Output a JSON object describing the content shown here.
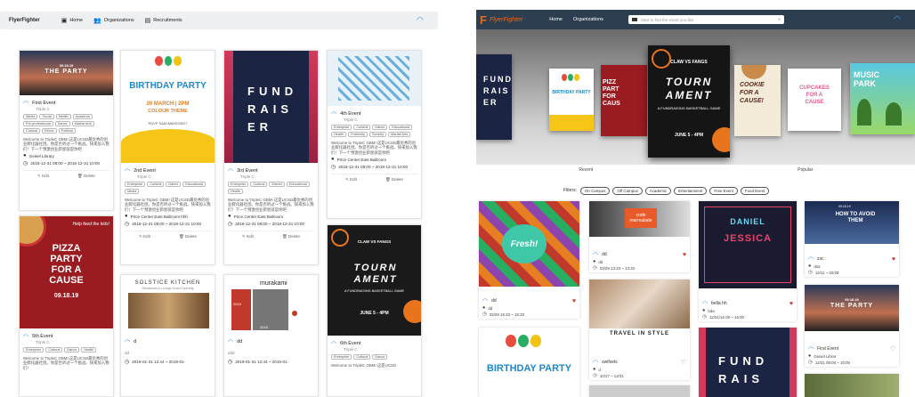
{
  "left": {
    "brand": "FlyerFighter",
    "nav": [
      {
        "label": "Home",
        "icon": "home-icon"
      },
      {
        "label": "Organizations",
        "icon": "people-icon"
      },
      {
        "label": "Recruitments",
        "icon": "document-icon"
      }
    ],
    "cards": [
      {
        "title": "First Event",
        "org": "Triple C",
        "tags": [
          "Media",
          "Social",
          "Health",
          "Academic",
          "Pre-professional",
          "Dance",
          "Martial Arts",
          "Cultural",
          "Ethnic",
          "Political"
        ],
        "desc": "Welcome to TripleC GBM! 这是UCSD最优秀的创业孵化器社团。你是否听过一个挑战。快来加入我们！下一个预激创业新星就是你吧",
        "location": "Geisel Library",
        "date": "2018-12-31 08:00 ~ 2018-12-31 10:00",
        "edit": "Edit",
        "delete": "Delete",
        "poster_top": "09.18.19",
        "poster_main": "THE PARTY"
      },
      {
        "title": "2nd Event",
        "org": "Triple C",
        "tags": [
          "Enterprise",
          "Cultural",
          "Dance",
          "Educational",
          "Media"
        ],
        "desc": "Welcome to TripleC GBM! 这是UCSD最优秀的创业孵化器社团。你是否听过一个挑战。快来加入我们！下一个预激创业新星就是你吧",
        "location": "Price Center East Ballroom hhh",
        "date": "2018-12-31 08:00 ~ 2018-12-31 10:00",
        "edit": "Edit",
        "delete": "Delete",
        "poster_main": "BIRTHDAY PARTY",
        "poster_sub": "20 MARCH | 2PM",
        "poster_sub2": "COLOUR THEME",
        "poster_rsvp": "RSVP SAM 8862533027"
      },
      {
        "title": "3rd Event",
        "org": "Triple C",
        "tags": [
          "Enterprise",
          "Cultural",
          "Marvel",
          "Educational",
          "Health"
        ],
        "desc": "Welcome to TripleC GBM! 这是UCSD最优秀的创业孵化器社团。你是否听过一个挑战。快来加入我们！下一个预激创业新星就是你吧",
        "location": "Price Center East Ballroom",
        "date": "2018-12-31 08:00 ~ 2018-12-31 10:00",
        "edit": "Edit",
        "delete": "Delete",
        "poster_lines": [
          "FUND",
          "RAIS",
          "ER"
        ]
      },
      {
        "title": "4th Event",
        "org": "Triple C",
        "tags": [
          "Enterprise",
          "Cultural",
          "Dance",
          "Educational",
          "Health",
          "Fraternity",
          "Sorority",
          "Martial Arts"
        ],
        "desc": "Welcome to TripleC GBM! 这是UCSD最优秀的创业孵化器社团。你是否听过一个挑战。快来加入我们！下一个预激创业新星就是你吧",
        "location": "Price Center East Ballroom",
        "date": "2018-12-31 08:00 ~ 2018-12-31 10:00",
        "edit": "Edit",
        "delete": "Delete"
      },
      {
        "title": "5th Event",
        "org": "Triple C",
        "tags": [
          "Enterprise",
          "Cultural",
          "Dance",
          "Health"
        ],
        "desc": "Welcome to TripleC GBM! 这是UCSD最优秀的创业孵化器社团。你是否听过一个挑战。快来加入我们！",
        "poster_script": "Help feed the kids!",
        "poster_lines": [
          "PIZZA",
          "PARTY",
          "FOR A",
          "CAUSE"
        ],
        "poster_date": "09.18.19"
      },
      {
        "title": "d",
        "org": "dd",
        "date": "2019-01-31 12:44 ~ 2019-01-",
        "poster_main": "SOLSTICE KITCHEN",
        "poster_sub": "Restaurant & Lounge Grand Opening"
      },
      {
        "title": "dd",
        "org": "ddd",
        "date": "2019-01-31 12:44 ~ 2019-01-",
        "poster_main": "murakami",
        "poster_left": "2019",
        "poster_mid": "2016"
      },
      {
        "title": "6th Event",
        "org": "Triple C",
        "tags": [
          "Enterprise",
          "Cultural",
          "Dance"
        ],
        "desc": "Welcome to TripleC GBM! 这是UCSD",
        "poster_top": "CLAW VS FANGS",
        "poster_main": "TOURN AMENT",
        "poster_sub": "A FUNDRAISING BASKETBALL GAME",
        "poster_date": "JUNE 5 - 4PM"
      }
    ]
  },
  "right": {
    "brand": "FlyerFighter",
    "nav": [
      "Home",
      "Organizations"
    ],
    "search_placeholder": "Start to find the event you like",
    "hero": {
      "left_text": [
        "FUND",
        "RAIS",
        "ER"
      ],
      "center_top": "CLAW VS FANGS",
      "center_main": [
        "TOURN",
        "AMENT"
      ],
      "center_sub": "A FUNDRAISING BASKETBALL GAME",
      "center_date": "JUNE 5 - 4PM",
      "pizza": [
        "PIZZ",
        "PART",
        "FOR",
        "CAUS"
      ],
      "birthday": "BIRTHDAY PARTY",
      "cookie": [
        "COOKIE",
        "FOR A",
        "CAUSE!"
      ],
      "cupcake": [
        "CUPCAKES",
        "FOR A",
        "CAUSE"
      ],
      "music": [
        "MUSIC",
        "PARK"
      ]
    },
    "tabs": [
      "Recent",
      "Popular"
    ],
    "filters_label": "Filters:",
    "filters": [
      "On Campus",
      "Off Campus",
      "Academic",
      "Entertainment",
      "Free Event",
      "Food Event"
    ],
    "cards": [
      {
        "title": "dd",
        "loc": "dd",
        "date": "03/29 15:33 ~ 15:33",
        "poster": "Fresh!"
      },
      {
        "title": "dd",
        "loc": "dd",
        "date": "03/29 13:33 ~ 13:33",
        "poster": "code marmalade"
      },
      {
        "title": "bella hh",
        "loc": "bda",
        "date": "12/31/16 00 ~ 16:00",
        "poster_top": "DANIEL",
        "poster_main": "JESSICA"
      },
      {
        "title": "zxc",
        "loc": "dsa",
        "date": "12/11 ~ 02/29",
        "poster_top": "09.18.19",
        "poster_main": "HOW TO AVOID THEM"
      },
      {
        "title": "swifsels",
        "loc": "d",
        "date": "10/17 ~ 12/31",
        "poster": "TRAVEL IN STYLE"
      },
      {
        "title": "First Event",
        "loc": "Geisel Librar",
        "date": "12/31 08:00 ~ 10:00",
        "poster_top": "09.18.19",
        "poster_main": "THE PARTY"
      },
      {
        "poster": "BIRTHDAY PARTY"
      },
      {
        "poster_lines": [
          "FUND",
          "RAIS"
        ]
      }
    ]
  }
}
